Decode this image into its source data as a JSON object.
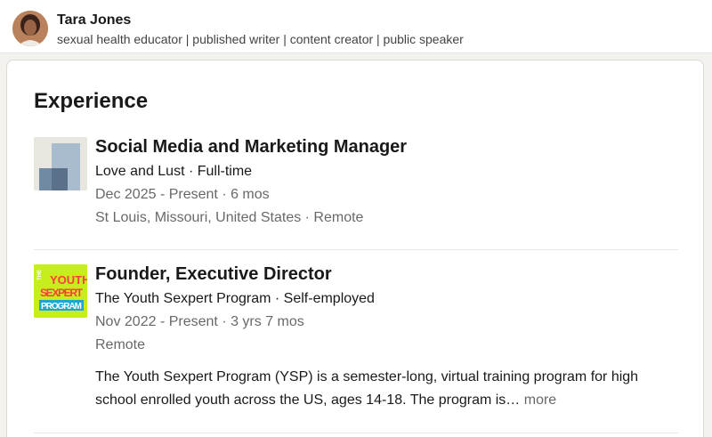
{
  "profile": {
    "name": "Tara Jones",
    "headline": "sexual health educator | published writer | content creator | public speaker"
  },
  "experience": {
    "title": "Experience",
    "items": [
      {
        "title": "Social Media and Marketing Manager",
        "company_line": "Love and Lust · Full-time",
        "dates": "Dec 2025 - Present · 6 mos",
        "location": "St Louis, Missouri, United States · Remote",
        "logo_icon": "building-placeholder-icon"
      },
      {
        "title": "Founder, Executive Director",
        "company_line": "The Youth Sexpert Program · Self-employed",
        "dates": "Nov 2022 - Present · 3 yrs 7 mos",
        "location": "Remote",
        "description": "The Youth Sexpert Program (YSP) is a semester-long, virtual training program for high school enrolled youth across the US, ages 14-18. The program is…",
        "more_label": "more",
        "logo_text": [
          "THE",
          "YOUTH",
          "SEXPERT",
          "PROGRAM"
        ],
        "logo_icon": "youth-sexpert-program-logo"
      }
    ]
  },
  "colors": {
    "page_bg": "#f4f2ee",
    "card_bg": "#ffffff",
    "logo2_bg": "#c6ee1c",
    "logo2_text": "#ff3c3c"
  }
}
